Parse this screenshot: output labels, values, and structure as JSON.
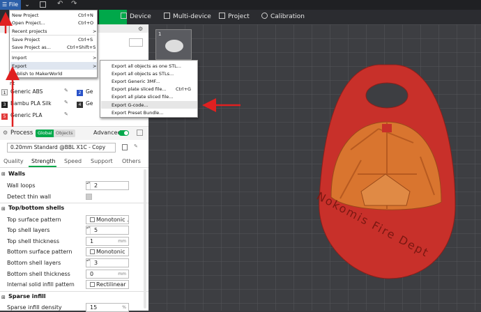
{
  "window": {
    "file_label": "File"
  },
  "tabs": [
    {
      "label": "Device"
    },
    {
      "label": "Multi-device"
    },
    {
      "label": "Project"
    },
    {
      "label": "Calibration"
    }
  ],
  "file_menu": {
    "items": [
      {
        "label": "New Project",
        "shortcut": "Ctrl+N"
      },
      {
        "label": "Open Project...",
        "shortcut": "Ctrl+O"
      },
      {
        "label": "Recent projects",
        "shortcut": ">"
      },
      {
        "label": "Save Project",
        "shortcut": "Ctrl+S"
      },
      {
        "label": "Save Project as...",
        "shortcut": "Ctrl+Shift+S"
      },
      {
        "label": "Import",
        "shortcut": ">"
      },
      {
        "label": "Export",
        "shortcut": ">"
      },
      {
        "label": "Publish to MakerWorld",
        "shortcut": ""
      }
    ]
  },
  "export_menu": {
    "items": [
      {
        "label": "Export all objects as one STL...",
        "shortcut": ""
      },
      {
        "label": "Export all objects as STLs...",
        "shortcut": ""
      },
      {
        "label": "Export Generic 3MF...",
        "shortcut": ""
      },
      {
        "label": "Export plate sliced file...",
        "shortcut": "Ctrl+G"
      },
      {
        "label": "Export all plate sliced file...",
        "shortcut": ""
      },
      {
        "label": "Export G-code...",
        "shortcut": ""
      },
      {
        "label": "Export Preset Bundle...",
        "shortcut": ""
      }
    ]
  },
  "filaments": [
    {
      "num": "1",
      "name": "Generic ABS",
      "color": "#f0f0f0",
      "text": "#222"
    },
    {
      "num": "2",
      "name": "Ge",
      "color": "#2a53c9",
      "text": "#fff"
    },
    {
      "num": "3",
      "name": "Bambu PLA Silk",
      "color": "#222222",
      "text": "#fff"
    },
    {
      "num": "4",
      "name": "Ge",
      "color": "#333333",
      "text": "#fff"
    },
    {
      "num": "5",
      "name": "Generic PLA",
      "color": "#e23b3b",
      "text": "#fff"
    }
  ],
  "filament_partial": "nt",
  "process": {
    "title": "Process",
    "global": "Global",
    "objects": "Objects",
    "advanced": "Advanced",
    "preset": "0.20mm Standard @BBL X1C - Copy"
  },
  "process_tabs": [
    "Quality",
    "Strength",
    "Speed",
    "Support",
    "Others"
  ],
  "walls": {
    "title": "Walls",
    "wall_loops_label": "Wall loops",
    "wall_loops": "2",
    "detect_thin_label": "Detect thin wall"
  },
  "shells": {
    "title": "Top/bottom shells",
    "top_pattern_label": "Top surface pattern",
    "top_pattern": "Monotonic ...",
    "top_layers_label": "Top shell layers",
    "top_layers": "5",
    "top_thick_label": "Top shell thickness",
    "top_thick": "1",
    "unit_mm": "mm",
    "bottom_pattern_label": "Bottom surface pattern",
    "bottom_pattern": "Monotonic",
    "bottom_layers_label": "Bottom shell layers",
    "bottom_layers": "3",
    "bottom_thick_label": "Bottom shell thickness",
    "bottom_thick": "0",
    "internal_label": "Internal solid infill pattern",
    "internal": "Rectilinear"
  },
  "infill": {
    "title": "Sparse infill",
    "density_label": "Sparse infill density",
    "density": "15",
    "unit_pct": "%"
  },
  "plate": {
    "number": "1"
  },
  "model_text": "Nokomis Fire Dept",
  "colors": {
    "accent": "#00a84a",
    "arrow": "#e02020",
    "model_red": "#c8302a",
    "model_orange": "#d9752f"
  }
}
